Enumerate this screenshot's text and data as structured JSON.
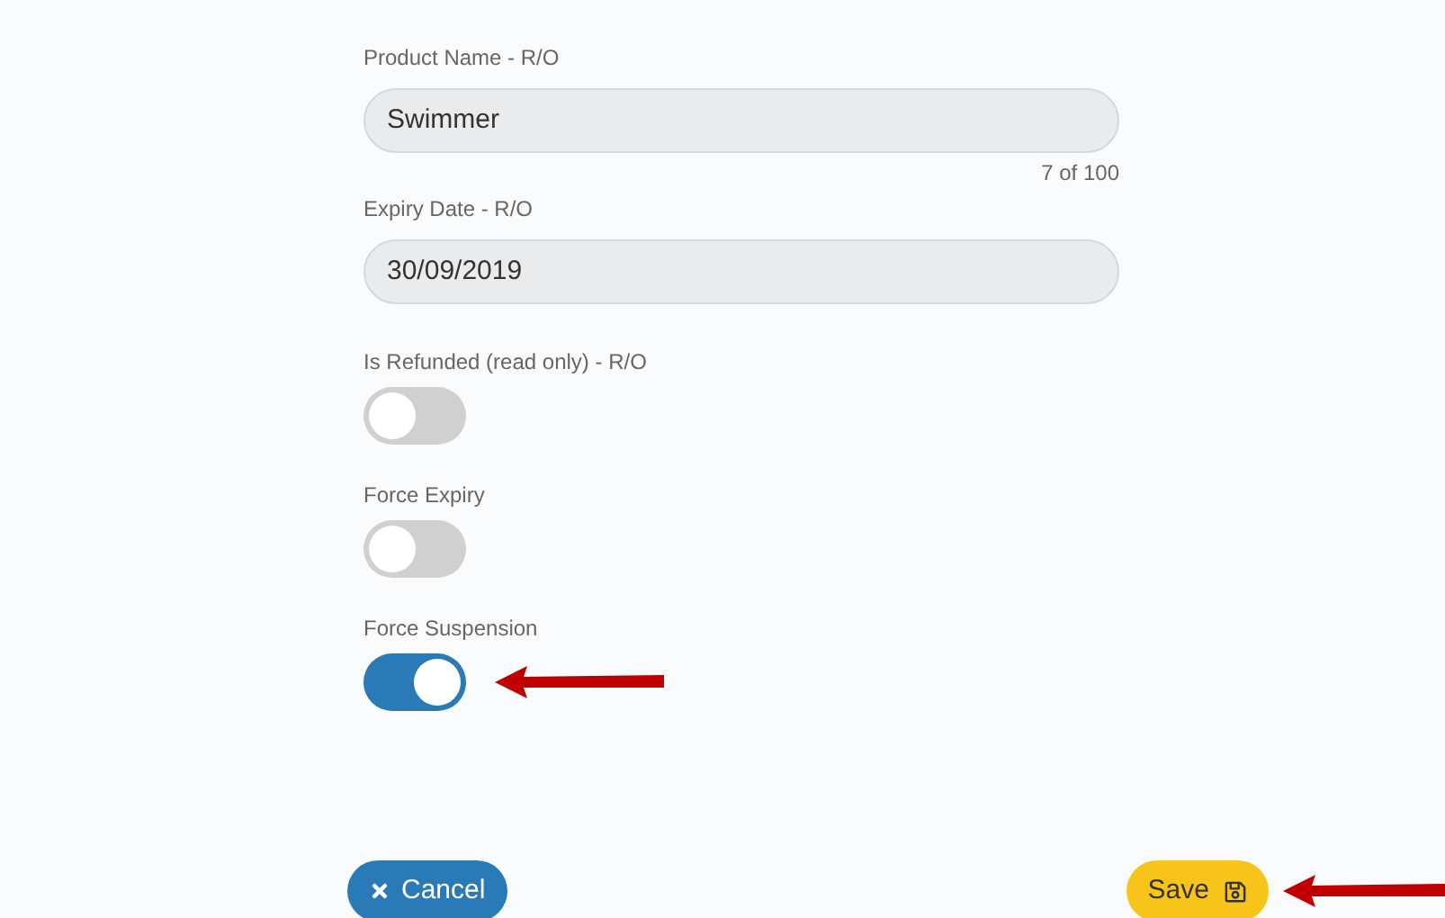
{
  "fields": [
    {
      "label": "Product Name - R/O",
      "value": "Swimmer",
      "counter": "7 of 100"
    },
    {
      "label": "Expiry Date - R/O",
      "value": "30/09/2019"
    }
  ],
  "toggles": [
    {
      "label": "Is Refunded (read only) - R/O",
      "on": false
    },
    {
      "label": "Force Expiry",
      "on": false
    },
    {
      "label": "Force Suspension",
      "on": true
    }
  ],
  "buttons": {
    "cancel": "Cancel",
    "save": "Save"
  }
}
